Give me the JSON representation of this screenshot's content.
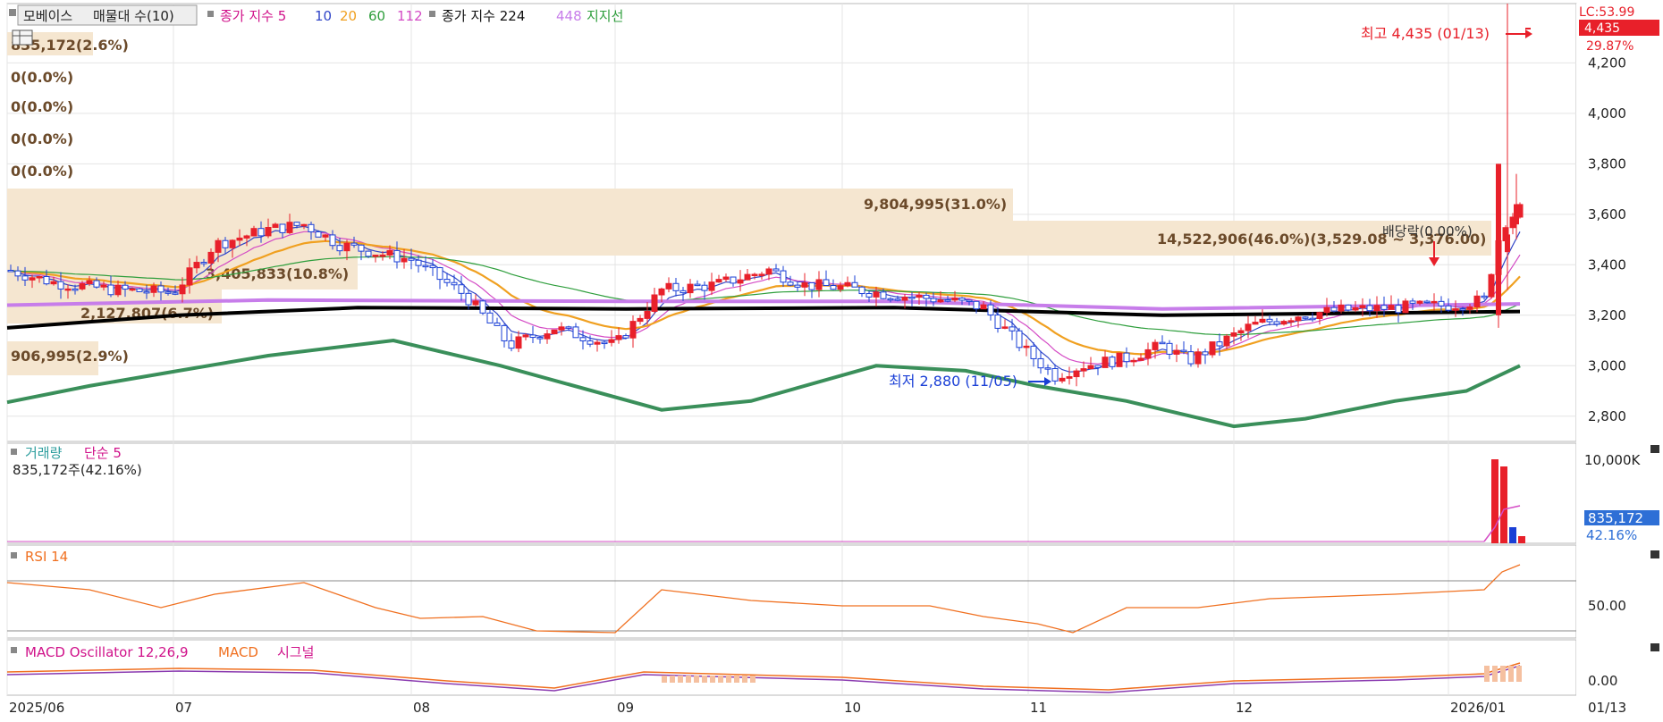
{
  "header": {
    "volume_profile_label": "매물대 수(10)",
    "volume_profile_prefix": "모베이스",
    "ma_label": "종가 지수 5",
    "ma_periods": [
      "10",
      "20",
      "60",
      "112"
    ],
    "ma2_label": "종가 지수 224",
    "ma2_period2": "448",
    "support_label": "지지선"
  },
  "right_top": {
    "lc_label": "LC:53.99",
    "price_box": "4,435",
    "change_pct": "29.87%"
  },
  "annotations": {
    "high": "최고 4,435 (01/13)",
    "low": "최저 2,880 (11/05)",
    "dividend": "배당락(0.00%)"
  },
  "volume_profile": [
    {
      "label": "835,172(2.6%)"
    },
    {
      "label": "0(0.0%)"
    },
    {
      "label": "0(0.0%)"
    },
    {
      "label": "0(0.0%)"
    },
    {
      "label": "0(0.0%)"
    },
    {
      "label": "9,804,995(31.0%)"
    },
    {
      "label": "14,522,906(46.0%)(3,529.08 ~ 3,376.00)"
    },
    {
      "label": "3,405,833(10.8%)"
    },
    {
      "label": "2,127,807(6.7%)"
    },
    {
      "label": "906,995(2.9%)"
    }
  ],
  "price_axis_labels": [
    "4,200",
    "4,000",
    "3,800",
    "3,600",
    "3,400",
    "3,200",
    "3,000",
    "2,800"
  ],
  "volume_panel": {
    "title": "거래량",
    "ma_label": "단순 5",
    "current": "835,172주(42.16%)",
    "axis_top": "10,000K",
    "value_box": "835,172",
    "pct": "42.16%"
  },
  "rsi_panel": {
    "title": "RSI 14",
    "axis_label": "50.00"
  },
  "macd_panel": {
    "title": "MACD Oscillator 12,26,9",
    "macd_label": "MACD",
    "signal_label": "시그널",
    "axis_label": "0.00"
  },
  "x_axis": [
    "2025/06",
    "07",
    "08",
    "09",
    "10",
    "11",
    "12",
    "2026/01"
  ],
  "x_axis_right": "01/13",
  "colors": {
    "up": "#e8202a",
    "down": "#1a3fd6",
    "ma5": "#3146c8",
    "ma10": "#d44bc5",
    "ma20": "#f0a020",
    "ma60": "#2e9e3c",
    "ma112": "#c77dea",
    "ma224": "#000000",
    "ma448": "#c77dea",
    "support": "#3a8f5a"
  },
  "chart_data": {
    "type": "line",
    "title": "",
    "x": [
      "2025/06",
      "2025/07",
      "2025/08",
      "2025/09",
      "2025/10",
      "2025/11",
      "2025/12",
      "2026/01",
      "01/13"
    ],
    "series": [
      {
        "name": "종가",
        "values": [
          3380,
          3500,
          3360,
          3080,
          3300,
          3000,
          3220,
          3260,
          4435
        ]
      },
      {
        "name": "448",
        "values": [
          2850,
          3150,
          3000,
          2820,
          3000,
          2900,
          2740,
          2860,
          2970
        ]
      }
    ],
    "ylim": [
      2700,
      4435
    ],
    "price_max": 4435,
    "price_min": 2880,
    "rsi_last": 70,
    "yticks": [
      2800,
      3000,
      3200,
      3400,
      3600,
      3800,
      4000,
      4200
    ]
  }
}
